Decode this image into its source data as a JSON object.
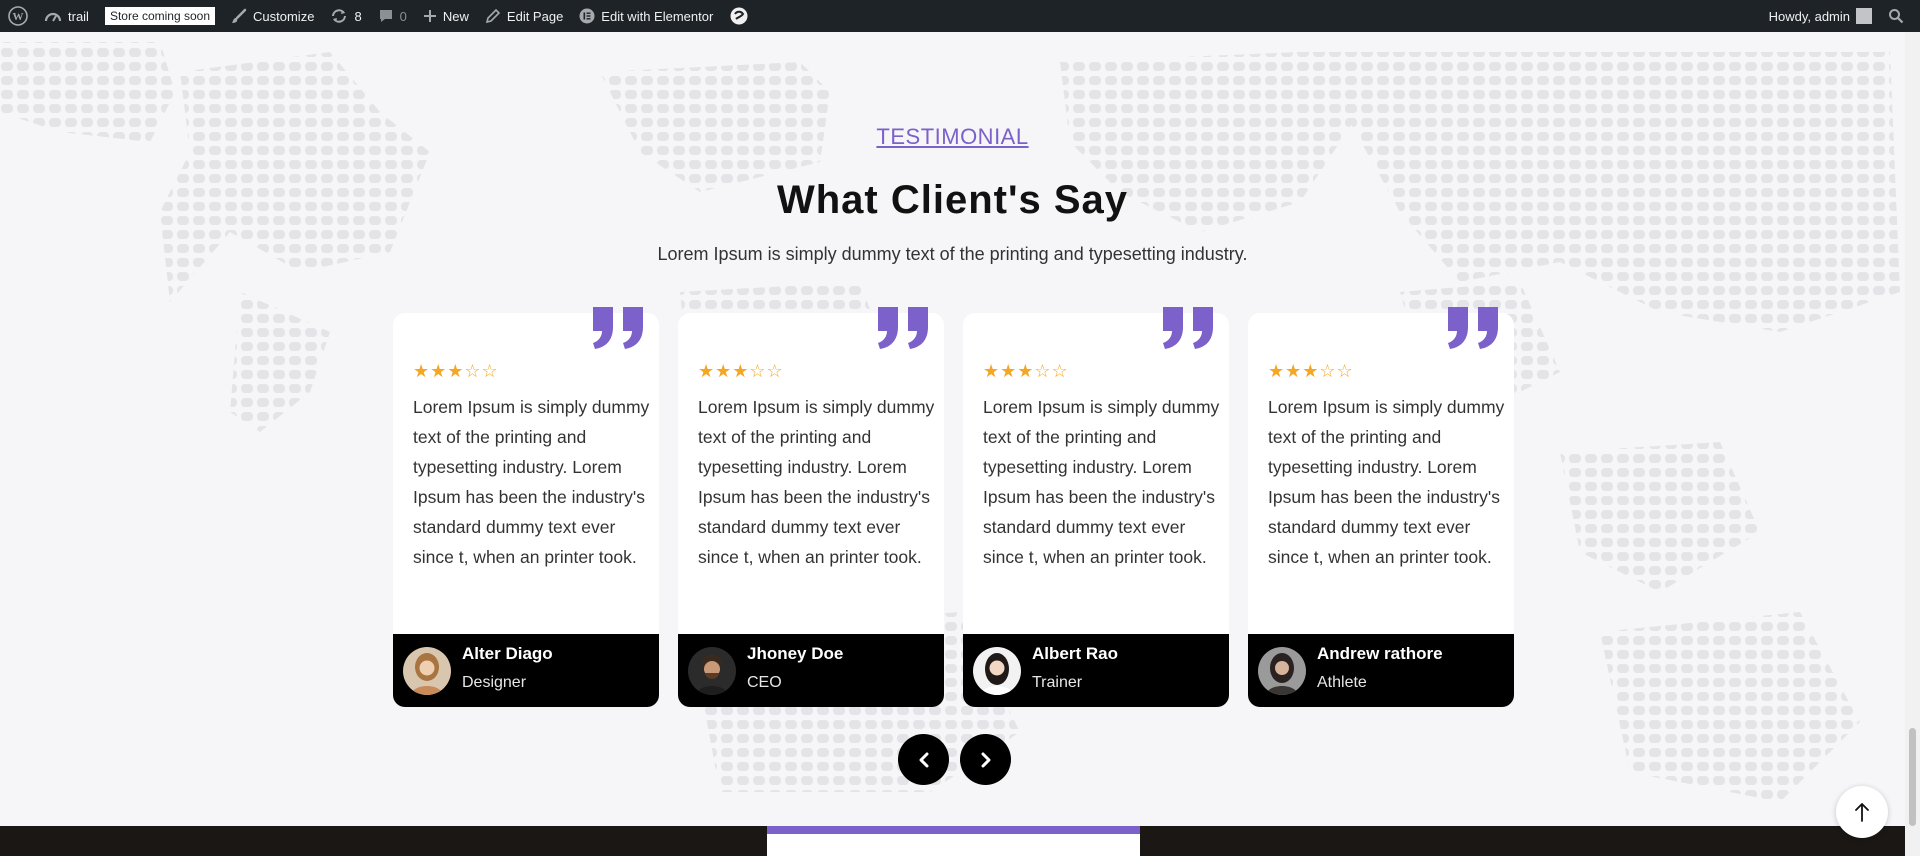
{
  "admin_bar": {
    "site_name": "trail",
    "store_badge": "Store coming soon",
    "customize": "Customize",
    "updates_count": "8",
    "comments_count": "0",
    "new": "New",
    "edit_page": "Edit Page",
    "edit_elementor": "Edit with Elementor",
    "howdy": "Howdy, admin"
  },
  "section": {
    "eyebrow": "TESTIMONIAL",
    "title": "What Client's Say",
    "subtitle": "Lorem Ipsum is simply dummy text of the printing and typesetting industry."
  },
  "testimonials": [
    {
      "rating": 3,
      "stars_filled": "★★★",
      "stars_empty": "☆☆",
      "text": "Lorem Ipsum is simply dummy text of the printing and typesetting industry. Lorem Ipsum has been the industry's standard dummy text ever since t, when an printer took.",
      "name": "Alter Diago",
      "role": "Designer"
    },
    {
      "rating": 3,
      "stars_filled": "★★★",
      "stars_empty": "☆☆",
      "text": "Lorem Ipsum is simply dummy text of the printing and typesetting industry. Lorem Ipsum has been the industry's standard dummy text ever since t, when an printer took.",
      "name": "Jhoney Doe",
      "role": "CEO"
    },
    {
      "rating": 3,
      "stars_filled": "★★★",
      "stars_empty": "☆☆",
      "text": "Lorem Ipsum is simply dummy text of the printing and typesetting industry. Lorem Ipsum has been the industry's standard dummy text ever since t, when an printer took.",
      "name": "Albert Rao",
      "role": "Trainer"
    },
    {
      "rating": 3,
      "stars_filled": "★★★",
      "stars_empty": "☆☆",
      "text": "Lorem Ipsum is simply dummy text of the printing and typesetting industry. Lorem Ipsum has been the industry's standard dummy text ever since t, when an printer took.",
      "name": "Andrew rathore",
      "role": "Athlete"
    }
  ],
  "icons": {
    "wp": "wordpress-logo-icon",
    "dashboard": "dashboard-icon",
    "customize": "brush-icon",
    "updates": "refresh-icon",
    "comments": "comment-icon",
    "new": "plus-icon",
    "edit": "pencil-icon",
    "elementor": "elementor-icon",
    "search": "search-icon",
    "quote": "quote-icon",
    "prev": "chevron-left-icon",
    "next": "chevron-right-icon",
    "top": "arrow-up-icon"
  },
  "colors": {
    "accent": "#7b61c9",
    "star": "#f5a623",
    "admin_bar": "#1d2327"
  }
}
